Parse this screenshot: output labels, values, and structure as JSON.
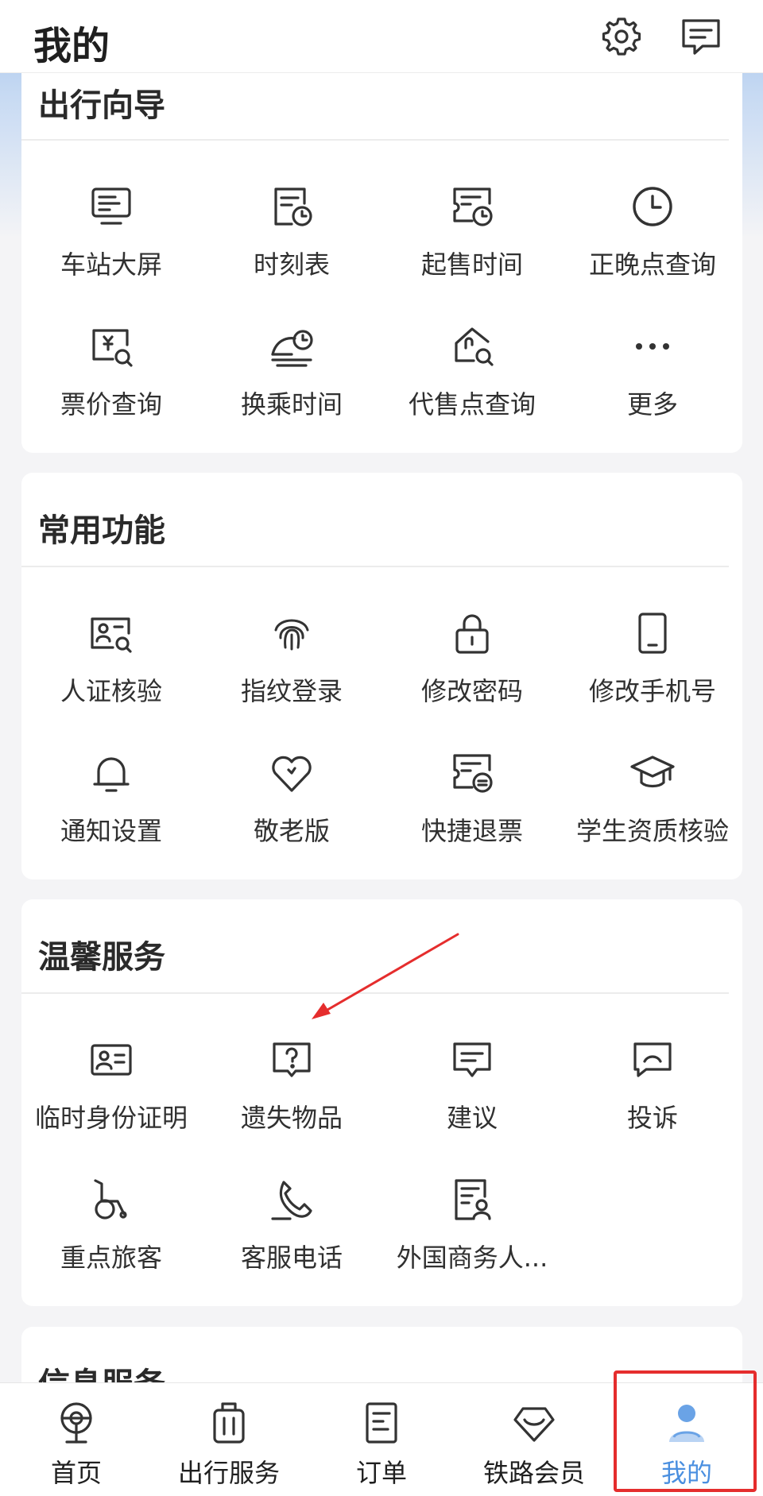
{
  "header": {
    "title": "我的",
    "icons": [
      "gear-icon",
      "message-icon"
    ]
  },
  "sections": [
    {
      "title": "出行向导",
      "items": [
        {
          "label": "车站大屏",
          "icon": "station-screen-icon"
        },
        {
          "label": "时刻表",
          "icon": "timetable-icon"
        },
        {
          "label": "起售时间",
          "icon": "sale-time-icon"
        },
        {
          "label": "正晚点查询",
          "icon": "clock-icon"
        },
        {
          "label": "票价查询",
          "icon": "fare-search-icon"
        },
        {
          "label": "换乘时间",
          "icon": "transfer-time-icon"
        },
        {
          "label": "代售点查询",
          "icon": "agency-search-icon"
        },
        {
          "label": "更多",
          "icon": "more-icon"
        }
      ]
    },
    {
      "title": "常用功能",
      "items": [
        {
          "label": "人证核验",
          "icon": "id-verify-icon"
        },
        {
          "label": "指纹登录",
          "icon": "fingerprint-icon"
        },
        {
          "label": "修改密码",
          "icon": "lock-icon"
        },
        {
          "label": "修改手机号",
          "icon": "phone-icon"
        },
        {
          "label": "通知设置",
          "icon": "bell-icon"
        },
        {
          "label": "敬老版",
          "icon": "heart-icon"
        },
        {
          "label": "快捷退票",
          "icon": "refund-ticket-icon"
        },
        {
          "label": "学生资质核验",
          "icon": "graduation-cap-icon"
        }
      ]
    },
    {
      "title": "温馨服务",
      "items": [
        {
          "label": "临时身份证明",
          "icon": "id-card-icon"
        },
        {
          "label": "遗失物品",
          "icon": "question-icon"
        },
        {
          "label": "建议",
          "icon": "suggestion-icon"
        },
        {
          "label": "投诉",
          "icon": "complaint-icon"
        },
        {
          "label": "重点旅客",
          "icon": "wheelchair-icon"
        },
        {
          "label": "客服电话",
          "icon": "phone-call-icon"
        },
        {
          "label": "外国商务人...",
          "icon": "foreign-business-icon"
        }
      ]
    },
    {
      "title": "信息服务",
      "items": []
    }
  ],
  "bottom_nav": [
    {
      "label": "首页",
      "icon": "home-icon",
      "active": false
    },
    {
      "label": "出行服务",
      "icon": "luggage-icon",
      "active": false
    },
    {
      "label": "订单",
      "icon": "order-icon",
      "active": false
    },
    {
      "label": "铁路会员",
      "icon": "member-icon",
      "active": false
    },
    {
      "label": "我的",
      "icon": "user-icon",
      "active": true
    }
  ],
  "colors": {
    "accent": "#4a8fe0",
    "annotation_red": "#e52d2d",
    "icon_stroke": "#333333"
  }
}
